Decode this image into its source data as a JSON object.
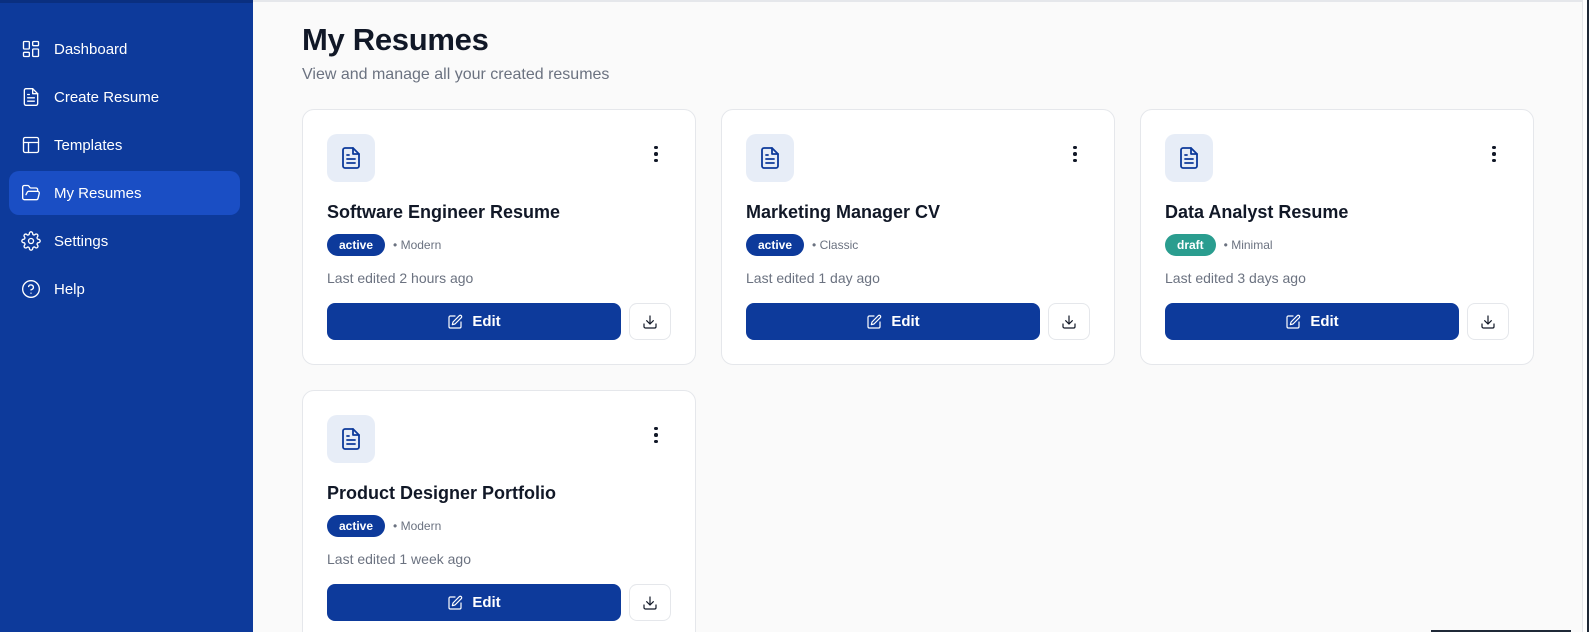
{
  "sidebar": {
    "items": [
      {
        "label": "Dashboard",
        "icon": "dashboard-icon"
      },
      {
        "label": "Create Resume",
        "icon": "file-text-icon"
      },
      {
        "label": "Templates",
        "icon": "layout-icon"
      },
      {
        "label": "My Resumes",
        "icon": "folder-open-icon",
        "active": true
      },
      {
        "label": "Settings",
        "icon": "gear-icon"
      },
      {
        "label": "Help",
        "icon": "help-circle-icon"
      }
    ]
  },
  "page": {
    "title": "My Resumes",
    "subtitle": "View and manage all your created resumes"
  },
  "resumes": [
    {
      "title": "Software Engineer Resume",
      "status": "active",
      "template": "• Modern",
      "edited": "Last edited 2 hours ago",
      "edit_label": "Edit"
    },
    {
      "title": "Marketing Manager CV",
      "status": "active",
      "template": "• Classic",
      "edited": "Last edited 1 day ago",
      "edit_label": "Edit"
    },
    {
      "title": "Data Analyst Resume",
      "status": "draft",
      "template": "• Minimal",
      "edited": "Last edited 3 days ago",
      "edit_label": "Edit"
    },
    {
      "title": "Product Designer Portfolio",
      "status": "active",
      "template": "• Modern",
      "edited": "Last edited 1 week ago",
      "edit_label": "Edit"
    }
  ],
  "colors": {
    "sidebar_bg": "#0d3a9b",
    "active_item": "#1a4ec4",
    "primary": "#0d3a9b",
    "draft_badge": "#2a9d8f"
  }
}
